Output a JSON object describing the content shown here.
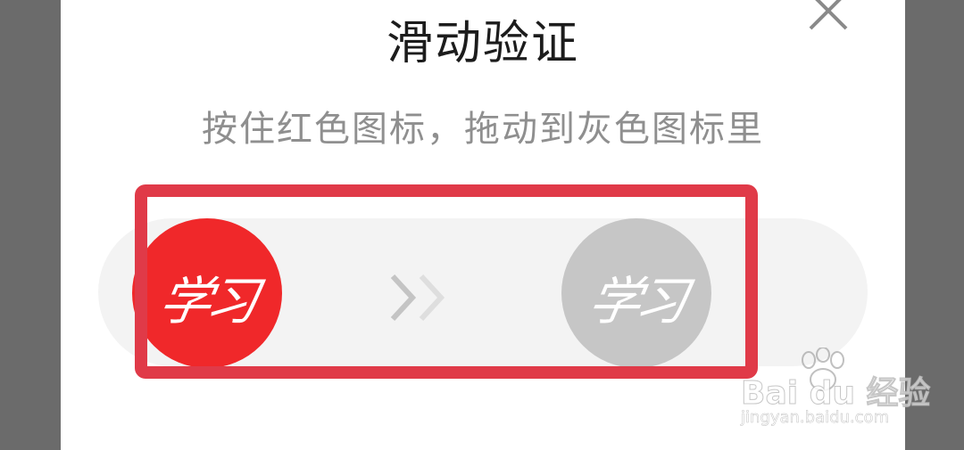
{
  "dialog": {
    "title": "滑动验证",
    "instruction": "按住红色图标，拖动到灰色图标里",
    "close_icon": "close-x-icon"
  },
  "slider": {
    "handle_logo_text": "学习",
    "target_logo_text": "学习",
    "handle_color": "#f0282a",
    "target_color": "#c6c6c6",
    "arrows_icon": "double-chevron-right-icon"
  },
  "annotation": {
    "highlight_color": "#e03a48"
  },
  "watermark": {
    "brand": "Bai du 经验",
    "url": "jingyan.baidu.com"
  }
}
